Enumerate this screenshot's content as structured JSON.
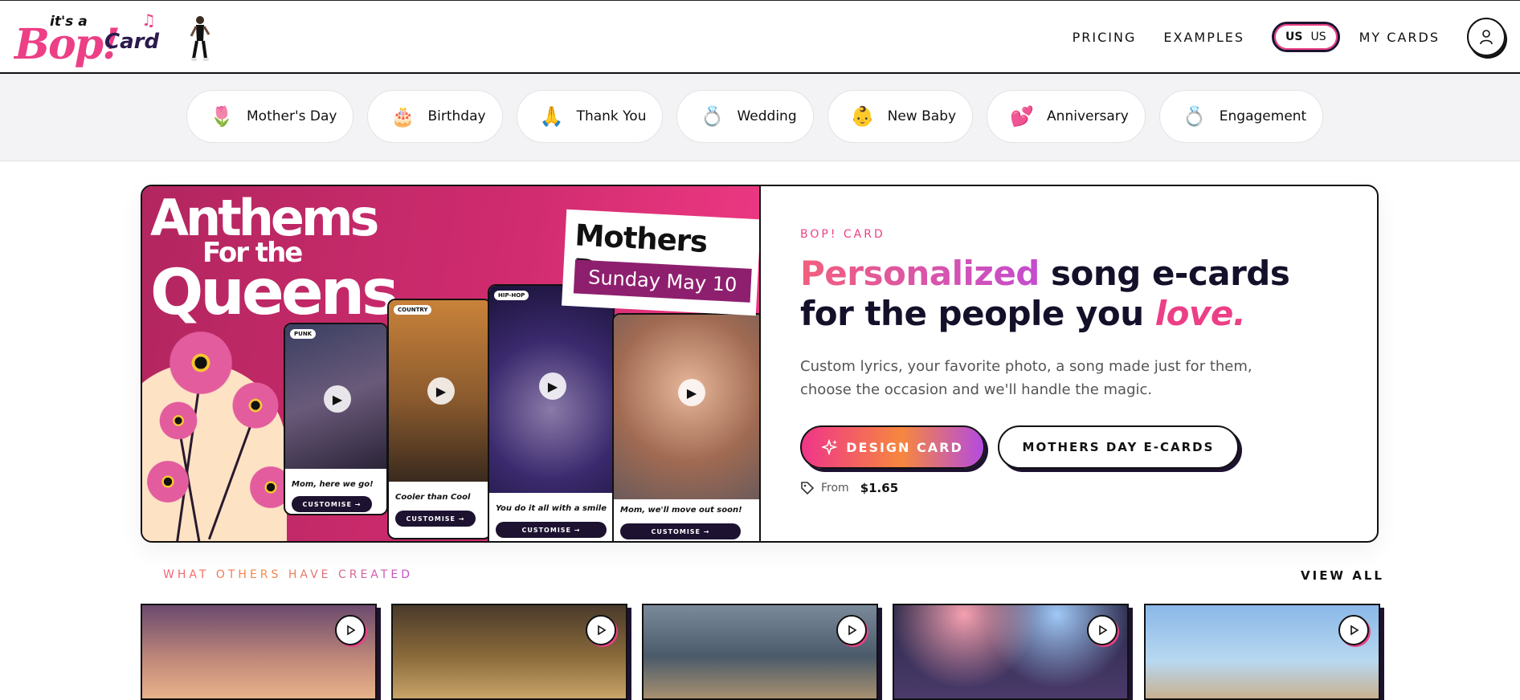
{
  "header": {
    "logo": {
      "small": "it's a",
      "bop": "Bop!",
      "card": "Card"
    },
    "nav": [
      {
        "label": "PRICING"
      },
      {
        "label": "EXAMPLES"
      }
    ],
    "locale": {
      "flag_text": "US",
      "label": "US"
    },
    "my_cards": "MY CARDS"
  },
  "categories": [
    {
      "label": "Mother's Day",
      "icon": "tulip-icon",
      "glyph": "🌷"
    },
    {
      "label": "Birthday",
      "icon": "cake-icon",
      "glyph": "🎂"
    },
    {
      "label": "Thank You",
      "icon": "folded-hands-icon",
      "glyph": "🙏"
    },
    {
      "label": "Wedding",
      "icon": "ring-icon",
      "glyph": "💍"
    },
    {
      "label": "New Baby",
      "icon": "baby-icon",
      "glyph": "👶"
    },
    {
      "label": "Anniversary",
      "icon": "hearts-icon",
      "glyph": "💕"
    },
    {
      "label": "Engagement",
      "icon": "ring-icon",
      "glyph": "💍"
    }
  ],
  "hero_image": {
    "title_line1": "Anthems",
    "title_line2": "For the",
    "title_line3": "Queens",
    "badge_title": "Mothers Day",
    "badge_date": "Sunday May 10",
    "phones": [
      {
        "genre": "PUNK",
        "caption": "Mom, here we go!",
        "button": "CUSTOMISE →"
      },
      {
        "genre": "COUNTRY",
        "caption": "Cooler than Cool",
        "button": "CUSTOMISE →"
      },
      {
        "genre": "HIP-HOP",
        "caption": "You do it all with a smile",
        "button": "CUSTOMISE →"
      },
      {
        "genre": "",
        "caption": "Mom, we'll move out soon!",
        "button": "CUSTOMISE →"
      }
    ]
  },
  "hero": {
    "eyebrow": "BOP! CARD",
    "headline_highlight": "Personalized",
    "headline_rest1": " song e-cards",
    "headline_line2": "for the people you ",
    "headline_love": "love.",
    "subtitle": "Custom lyrics, your favorite photo, a song made just for them, choose the occasion and we'll handle the magic.",
    "design_button": "DESIGN CARD",
    "mothers_day_button": "MOTHERS DAY E-CARDS",
    "price_prefix": "From",
    "price_value": "$1.65"
  },
  "gallery": {
    "title": "WHAT OTHERS HAVE CREATED",
    "view_all": "VIEW ALL"
  },
  "colors": {
    "brand_pink": "#ec3f86",
    "brand_navy": "#1d1230",
    "hero_magenta": "#cf2b6e"
  }
}
